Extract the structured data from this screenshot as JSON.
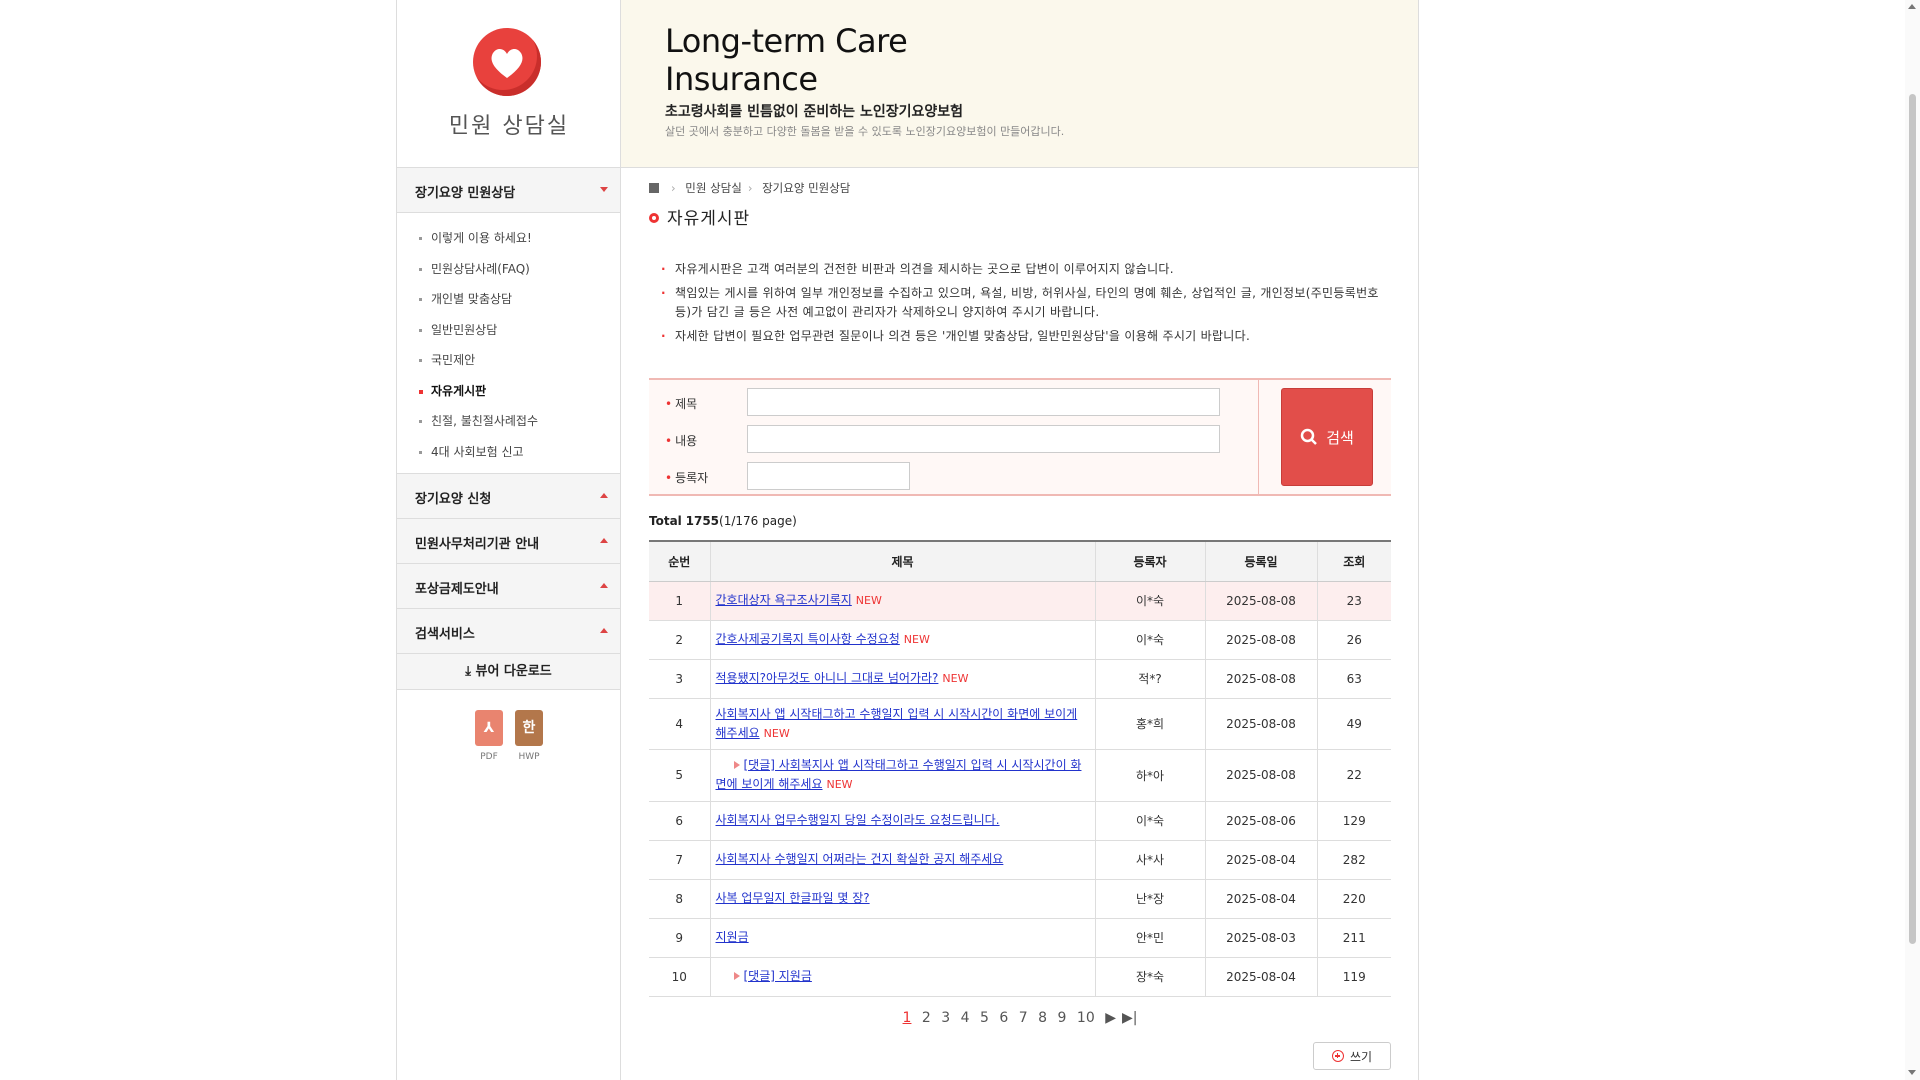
{
  "sidebar": {
    "logo_text": "민원 상담실",
    "section1": {
      "title": "장기요양 민원상담"
    },
    "items": [
      {
        "label": "이렇게 이용 하세요!"
      },
      {
        "label": "민원상담사례(FAQ)"
      },
      {
        "label": "개인별 맞춤상담"
      },
      {
        "label": "일반민원상담"
      },
      {
        "label": "국민제안"
      },
      {
        "label": "자유게시판"
      },
      {
        "label": "친절, 불친절사례접수"
      },
      {
        "label": "4대 사회보험 신고"
      }
    ],
    "sections": [
      {
        "title": "장기요양 신청"
      },
      {
        "title": "민원사무처리기관 안내"
      },
      {
        "title": "포상금제도안내"
      },
      {
        "title": "검색서비스"
      }
    ],
    "viewer_download": "뷰어 다운로드",
    "pdf_label": "PDF",
    "hwp_label": "HWP",
    "hwp_glyph": "한"
  },
  "banner": {
    "title_line1": "Long-term Care",
    "title_line2": "Insurance",
    "subtitle": "초고령사회를 빈틈없이 준비하는 노인장기요양보험",
    "description": "살던 곳에서 충분하고 다양한 돌봄을 받을 수 있도록 노인장기요양보험이 만들어갑니다."
  },
  "breadcrumb": {
    "level1": "민원 상담실",
    "level2": "장기요양 민원상담"
  },
  "page_title": "자유게시판",
  "notices": [
    "자유게시판은 고객 여러분의 건전한 비판과 의견을 제시하는 곳으로 답변이 이루어지지 않습니다.",
    "책임있는 게시를 위하여 일부 개인정보를 수집하고 있으며, 욕설, 비방, 허위사실, 타인의 명예 훼손, 상업적인 글, 개인정보(주민등록번호 등)가 담긴 글 등은 사전 예고없이 관리자가 삭제하오니 양지하여 주시기 바랍니다.",
    "자세한 답변이 필요한 업무관련 질문이나 의견 등은 '개인별 맞춤상담, 일반민원상담'을 이용해 주시기 바랍니다."
  ],
  "search": {
    "title_label": "제목",
    "content_label": "내용",
    "author_label": "등록자",
    "button_label": "검색"
  },
  "total": {
    "label": "Total",
    "count": "1755",
    "pages": "(1/176 page)"
  },
  "table": {
    "headers": [
      "순번",
      "제목",
      "등록자",
      "등록일",
      "조회"
    ],
    "new_tag": "NEW",
    "rows": [
      {
        "no": "1",
        "title": "간호대상자 욕구조사기록지",
        "author": "이*숙",
        "date": "2025-08-08",
        "views": "23"
      },
      {
        "no": "2",
        "title": "간호사제공기록지 특이사항 수정요청",
        "author": "이*숙",
        "date": "2025-08-08",
        "views": "26"
      },
      {
        "no": "3",
        "title": "적용됐지?아무것도 아니니 그대로 넘어가라?",
        "author": "적*?",
        "date": "2025-08-08",
        "views": "63"
      },
      {
        "no": "4",
        "title": "사회복지사 앱 시작태그하고 수행일지 입력 시 시작시간이 화면에 보이게 해주세요",
        "author": "홍*희",
        "date": "2025-08-08",
        "views": "49"
      },
      {
        "no": "5",
        "title": "[댓글] 사회복지사 앱 시작태그하고 수행일지 입력 시 시작시간이 화면에 보이게 해주세요",
        "author": "하*아",
        "date": "2025-08-08",
        "views": "22"
      },
      {
        "no": "6",
        "title": "사회복지사 업무수행일지 당일 수정이라도 요청드립니다.",
        "author": "이*숙",
        "date": "2025-08-06",
        "views": "129"
      },
      {
        "no": "7",
        "title": "사회복지사 수행일지 어쩌라는 건지 확실한 공지 해주세요",
        "author": "사*사",
        "date": "2025-08-04",
        "views": "282"
      },
      {
        "no": "8",
        "title": "사복 업무일지 한글파일 몇 장?",
        "author": "난*장",
        "date": "2025-08-04",
        "views": "220"
      },
      {
        "no": "9",
        "title": "지원금",
        "author": "안*민",
        "date": "2025-08-03",
        "views": "211"
      },
      {
        "no": "10",
        "title": "[댓글] 지원금",
        "author": "장*숙",
        "date": "2025-08-04",
        "views": "119"
      }
    ]
  },
  "pager": {
    "pages": [
      "1",
      "2",
      "3",
      "4",
      "5",
      "6",
      "7",
      "8",
      "9",
      "10"
    ],
    "next": "▶",
    "last": "▶|"
  },
  "write_button": "쓰기",
  "colors": {
    "accent": "#e24e4a",
    "link": "#2233cc",
    "banner_bg": "#fbf8ec"
  }
}
